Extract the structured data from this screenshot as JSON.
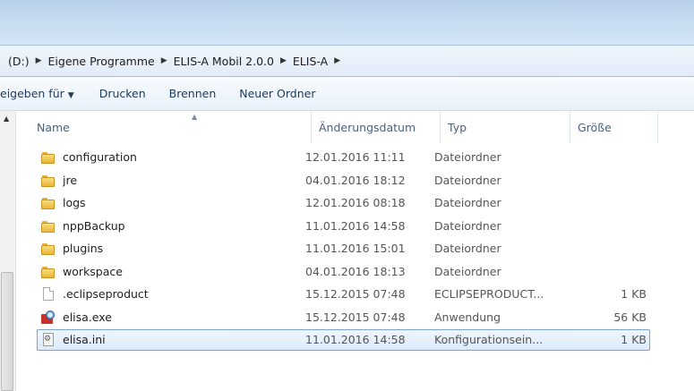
{
  "address": {
    "crumbs": [
      "(D:)",
      "Eigene Programme",
      "ELIS-A Mobil 2.0.0",
      "ELIS-A"
    ]
  },
  "toolbar": {
    "share_label": "eigeben für",
    "print_label": "Drucken",
    "burn_label": "Brennen",
    "new_folder_label": "Neuer Ordner"
  },
  "columns": {
    "name": "Name",
    "date": "Änderungsdatum",
    "type": "Typ",
    "size": "Größe"
  },
  "files": [
    {
      "name": "configuration",
      "date": "12.01.2016 11:11",
      "type": "Dateiordner",
      "size": "",
      "icon": "folder-icon"
    },
    {
      "name": "jre",
      "date": "04.01.2016 18:12",
      "type": "Dateiordner",
      "size": "",
      "icon": "folder-icon"
    },
    {
      "name": "logs",
      "date": "12.01.2016 08:18",
      "type": "Dateiordner",
      "size": "",
      "icon": "folder-icon"
    },
    {
      "name": "nppBackup",
      "date": "11.01.2016 14:58",
      "type": "Dateiordner",
      "size": "",
      "icon": "folder-icon"
    },
    {
      "name": "plugins",
      "date": "11.01.2016 15:01",
      "type": "Dateiordner",
      "size": "",
      "icon": "folder-icon"
    },
    {
      "name": "workspace",
      "date": "04.01.2016 18:13",
      "type": "Dateiordner",
      "size": "",
      "icon": "folder-icon"
    },
    {
      "name": ".eclipseproduct",
      "date": "15.12.2015 07:48",
      "type": "ECLIPSEPRODUCT...",
      "size": "1 KB",
      "icon": "file-icon"
    },
    {
      "name": "elisa.exe",
      "date": "15.12.2015 07:48",
      "type": "Anwendung",
      "size": "56 KB",
      "icon": "exe-icon"
    },
    {
      "name": "elisa.ini",
      "date": "11.01.2016 14:58",
      "type": "Konfigurationsein...",
      "size": "1 KB",
      "icon": "ini-icon",
      "selected": true
    }
  ]
}
